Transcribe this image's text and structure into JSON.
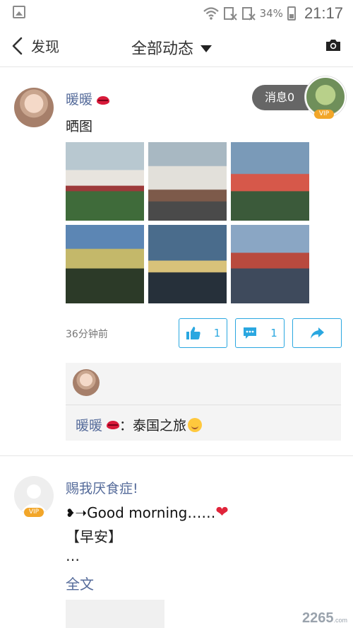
{
  "status_bar": {
    "battery": "34%",
    "time": "21:17"
  },
  "header": {
    "back_label": "发现",
    "title": "全部动态"
  },
  "post1": {
    "username": "暖暖",
    "text": "晒图",
    "time": "36分钟前",
    "likes": "1",
    "comments": "1",
    "message_pill": "消息0",
    "vip_badge": "VIP",
    "comment": {
      "user": "暖暖",
      "text": "：泰国之旅"
    }
  },
  "post2": {
    "username": "赐我厌食症!",
    "line1": "➝Good morning……",
    "line2": "【早安】",
    "line3": "…",
    "full_text_link": "全文",
    "vip_badge": "VIP"
  },
  "watermark": {
    "brand": "2265",
    "suffix": ".com"
  },
  "colors": {
    "accent": "#2aa7e0",
    "username": "#556b9a",
    "pill": "#666666"
  }
}
